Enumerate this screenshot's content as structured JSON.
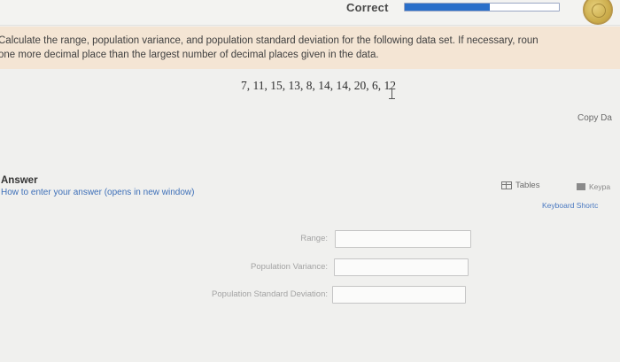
{
  "header": {
    "status_label": "Correct",
    "progress_fraction": 0.55,
    "coin_icon": "gold-coin-icon"
  },
  "question": {
    "prompt_line1": "Calculate the range, population variance, and population standard deviation for the following data set. If necessary, roun",
    "prompt_line2": "one more decimal place than the largest number of decimal places given in the data.",
    "data_values": "7, 11, 15, 13, 8, 14, 14, 20, 6, 12",
    "copy_data_label": "Copy Da"
  },
  "answer": {
    "title": "Answer",
    "help_link": "How to enter your answer (opens in new window)",
    "tables_label": "Tables",
    "keypad_label": "Keypa",
    "shortcuts_link": "Keyboard Shortc",
    "fields": {
      "range_label": "Range:",
      "variance_label": "Population Variance:",
      "sd_label": "Population Standard Deviation:"
    }
  },
  "colors": {
    "accent": "#2a6fc9",
    "prompt_background": "#f4e5d4",
    "link": "#3d6fb8"
  }
}
